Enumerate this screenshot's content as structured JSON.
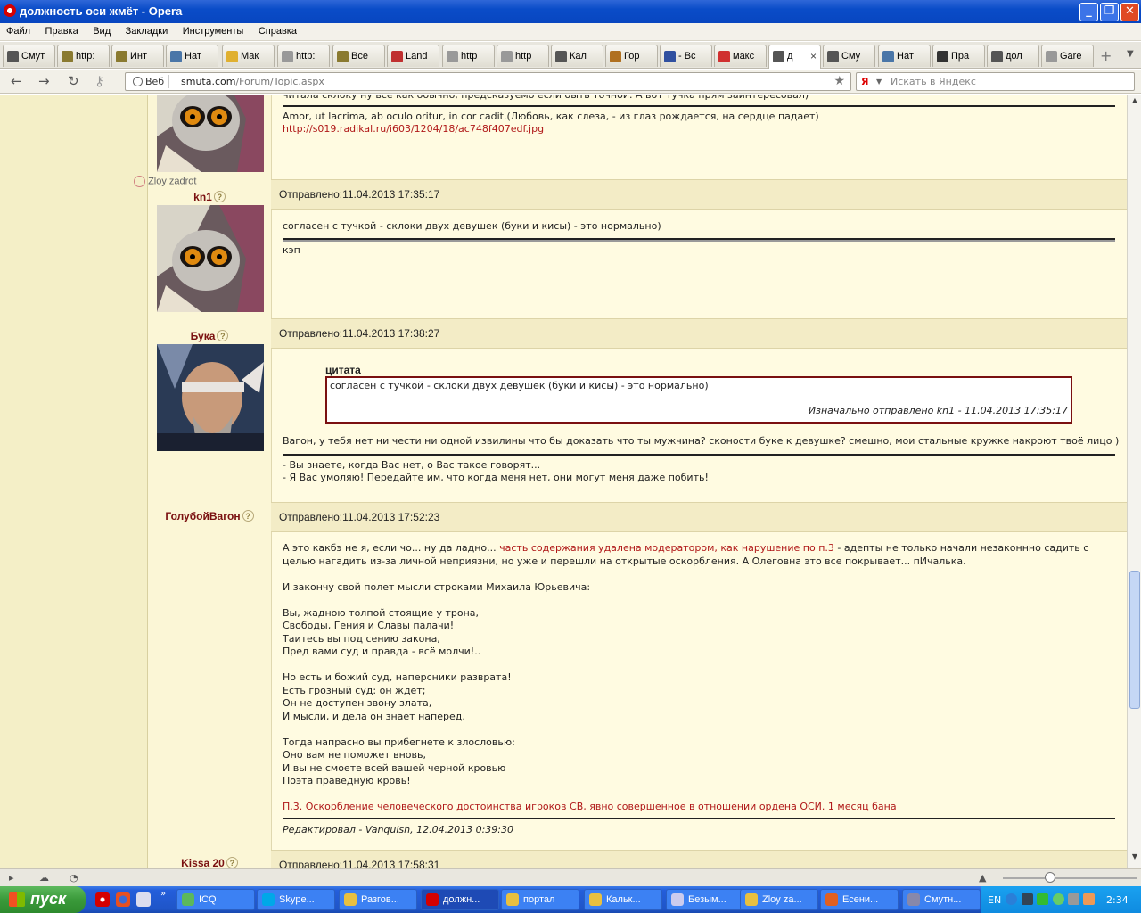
{
  "window": {
    "title": "должность оси жмёт - Opera",
    "min": "_",
    "max": "❐",
    "close": "✕"
  },
  "menu": [
    "Файл",
    "Правка",
    "Вид",
    "Закладки",
    "Инструменты",
    "Справка"
  ],
  "tabs": [
    {
      "label": "Смут",
      "color": "#555"
    },
    {
      "label": "http:",
      "color": "#8a7a30"
    },
    {
      "label": "Инт",
      "color": "#8a7a30"
    },
    {
      "label": "Нат",
      "color": "#4a76a8"
    },
    {
      "label": "Мак",
      "color": "#e0b030"
    },
    {
      "label": "http:",
      "color": "#999"
    },
    {
      "label": "Все",
      "color": "#8a7a30"
    },
    {
      "label": "Land",
      "color": "#c03030"
    },
    {
      "label": "http",
      "color": "#999"
    },
    {
      "label": "http",
      "color": "#999"
    },
    {
      "label": "Кал",
      "color": "#555"
    },
    {
      "label": "Гор",
      "color": "#b07020"
    },
    {
      "label": "- Вс",
      "color": "#3050a0"
    },
    {
      "label": "макс",
      "color": "#d03030"
    },
    {
      "label": "д",
      "color": "#555",
      "active": true
    },
    {
      "label": "Сму",
      "color": "#555"
    },
    {
      "label": "Нат",
      "color": "#4a76a8"
    },
    {
      "label": "Пра",
      "color": "#333"
    },
    {
      "label": "дол",
      "color": "#555"
    },
    {
      "label": "Gare",
      "color": "#999"
    }
  ],
  "addressbar": {
    "badge": "Веб",
    "url_host": "smuta.com",
    "url_path": "/Forum/Topic.aspx"
  },
  "search": {
    "placeholder": "Искать в Яндекс",
    "engine_icon": "Я"
  },
  "posts": {
    "p0": {
      "line1": "читала склоку ну все как обычно, предсказуемо если быть точной. А вот тучка прям заинтересовал)",
      "sig1": "Amor, ut lacrima, ab oculo oritur, in cor cadit.(Любовь, как слеза, - из глаз рождается, на сердце падает)",
      "sig2": "http://s019.radikal.ru/i603/1204/18/ac748f407edf.jpg"
    },
    "p1": {
      "rank": "Zloy zadrot",
      "author": "kn1",
      "date": "Отправлено:11.04.2013 17:35:17",
      "text": "согласен с тучкой - склоки двух девушек (буки и кисы) - это нормально)",
      "sig": "кэп"
    },
    "p2": {
      "author": "Бука",
      "date": "Отправлено:11.04.2013 17:38:27",
      "quote_title": "цитата",
      "quote_text": "согласен с тучкой - склоки двух девушек (буки и кисы) - это нормально)",
      "quote_src": "Изначально отправлено kn1 - 11.04.2013 17:35:17",
      "text": "Вагон, у тебя нет ни чести ни одной извилины что бы доказать что ты мужчина? сконости буке к девушке? смешно, мои стальные кружке накроют твоё лицо )",
      "sig1": "- Вы знаете, когда Вас нет, о Вас такое говорят...",
      "sig2": "- Я Вас умоляю! Передайте им, что когда меня нет, они могут меня даже побить!"
    },
    "p3": {
      "author": "ГолубойВагон",
      "date": "Отправлено:11.04.2013 17:52:23",
      "l1a": "А это какбэ не я, если чо... ну да ладно... ",
      "l1b": "часть содержания удалена модератором, как нарушение по п.3",
      "l1c": " - адепты не только начали незаконнно садить с",
      "l2": "целью нагадить из-за личной неприязни, но уже и перешли на открытые оскорбления. А Олеговна это все покрывает... пИчалька.",
      "l3": "И закончу свой полет мысли строками Михаила Юрьевича:",
      "v1": "Вы, жадною толпой стоящие у трона,",
      "v2": "Свободы, Гения и Славы палачи!",
      "v3": "Таитесь вы под сению закона,",
      "v4": "Пред вами суд и правда - всё молчи!..",
      "v5": "Но есть и божий суд, наперсники разврата!",
      "v6": "Есть грозный суд: он ждет;",
      "v7": "Он не доступен звону злата,",
      "v8": "И мысли, и дела он знает наперед.",
      "v9": "Тогда напрасно вы прибегнете к злословью:",
      "v10": "Оно вам не поможет вновь,",
      "v11": "И вы не смоете всей вашей черной кровью",
      "v12": "Поэта праведную кровь!",
      "mod": "П.3. Оскорбление человеческого достоинства игроков СВ, явно совершенное в отношении ордена ОСИ. 1 месяц бана",
      "edited": "Редактировал - Vanquish, 12.04.2013 0:39:30"
    },
    "p4": {
      "author": "Kissa 20",
      "date": "Отправлено:11.04.2013 17:58:31"
    }
  },
  "taskbar": {
    "start": "пуск",
    "tasks": [
      {
        "label": "ICQ",
        "color": "#5cb85c"
      },
      {
        "label": "Skype...",
        "color": "#00a8e8"
      },
      {
        "label": "Разгов...",
        "color": "#e8c040"
      },
      {
        "label": "должн...",
        "color": "#d40000",
        "active": true
      },
      {
        "label": "портал",
        "color": "#e8c040"
      },
      {
        "label": "Кальк...",
        "color": "#e8c040"
      },
      {
        "label": "Безым...",
        "color": "#cce"
      },
      {
        "label": "Zloy za...",
        "color": "#e8c040"
      },
      {
        "label": "Есени...",
        "color": "#e06020"
      },
      {
        "label": "Смутн...",
        "color": "#88a"
      }
    ],
    "lang": "EN",
    "clock": "2:34"
  }
}
